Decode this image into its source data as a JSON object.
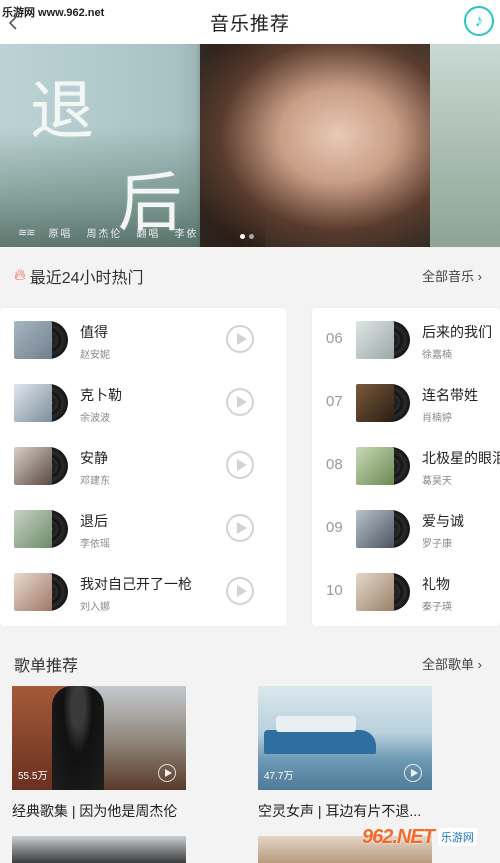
{
  "watermark_top": "乐游网 www.962.net",
  "header": {
    "title": "音乐推荐",
    "music_icon": "music-note-icon"
  },
  "banner": {
    "title_char_1": "退",
    "title_char_2": "后",
    "meta": [
      "原唱",
      "周杰伦",
      "翻唱",
      "李依"
    ]
  },
  "hot_section": {
    "title": "最近24小时热门",
    "more": "全部音乐 ›"
  },
  "hot_songs_left": [
    {
      "name": "值得",
      "artist": "赵安妮"
    },
    {
      "name": "克卜勒",
      "artist": "余波波"
    },
    {
      "name": "安静",
      "artist": "邓建东"
    },
    {
      "name": "退后",
      "artist": "李依瑶"
    },
    {
      "name": "我对自己开了一枪",
      "artist": "刘入娜"
    }
  ],
  "hot_songs_right": [
    {
      "rank": "06",
      "name": "后来的我们",
      "artist": "徐嘉楠"
    },
    {
      "rank": "07",
      "name": "连名带姓",
      "artist": "肖楠婷"
    },
    {
      "rank": "08",
      "name": "北极星的眼泪",
      "artist": "葛昊天"
    },
    {
      "rank": "09",
      "name": "爱与诚",
      "artist": "罗子康"
    },
    {
      "rank": "10",
      "name": "礼物",
      "artist": "秦子瑛"
    }
  ],
  "playlist_section": {
    "title": "歌单推荐",
    "more": "全部歌单 ›"
  },
  "playlists": [
    {
      "count": "55.5万",
      "title": "经典歌集 | 因为他是周杰伦"
    },
    {
      "count": "47.7万",
      "title": "空灵女声 | 耳边有片不退..."
    }
  ],
  "watermark_bottom": {
    "logo": "962.NET",
    "text": "乐游网"
  }
}
